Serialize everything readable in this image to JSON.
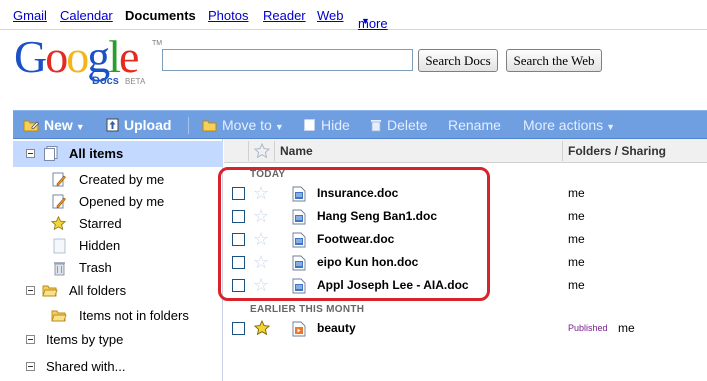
{
  "topnav": {
    "gmail": "Gmail",
    "calendar": "Calendar",
    "documents": "Documents",
    "photos": "Photos",
    "reader": "Reader",
    "web": "Web",
    "more": "more",
    "more_arrow": "▼"
  },
  "logo": {
    "word": "Google",
    "product": "Docs",
    "beta": "BETA",
    "tm": "TM"
  },
  "search": {
    "query": "",
    "search_docs_label": "Search Docs",
    "search_web_label": "Search the Web"
  },
  "toolbar": {
    "new_label": "New",
    "upload_label": "Upload",
    "move_to_label": "Move to",
    "hide_label": "Hide",
    "delete_label": "Delete",
    "rename_label": "Rename",
    "more_actions_label": "More actions",
    "arrow": "▼"
  },
  "sidebar": {
    "all_items": "All items",
    "created_by_me": "Created by me",
    "opened_by_me": "Opened by me",
    "starred": "Starred",
    "hidden": "Hidden",
    "trash": "Trash",
    "all_folders": "All folders",
    "items_not_in_folders": "Items not in folders",
    "items_by_type": "Items by type",
    "shared_with": "Shared with..."
  },
  "list": {
    "col_name": "Name",
    "col_folders": "Folders / Sharing",
    "section_today": "TODAY",
    "section_earlier": "EARLIER THIS MONTH",
    "today": [
      {
        "name": "Insurance.doc",
        "sharing": "me",
        "starred": false
      },
      {
        "name": "Hang Seng Ban1.doc",
        "sharing": "me",
        "starred": false
      },
      {
        "name": "Footwear.doc",
        "sharing": "me",
        "starred": false
      },
      {
        "name": "eipo Kun hon.doc",
        "sharing": "me",
        "starred": false
      },
      {
        "name": "Appl Joseph Lee - AIA.doc",
        "sharing": "me",
        "starred": false
      }
    ],
    "earlier": [
      {
        "name": "beauty",
        "published": "Published",
        "sharing": "me",
        "starred": true
      }
    ]
  },
  "colors": {
    "toolbar_bg": "#6f9fe0",
    "selected_bg": "#c3d9ff",
    "highlight": "#d9232b",
    "link": "#0000cc"
  },
  "icons": {
    "new": "folder-pencil-icon",
    "upload": "upload-icon",
    "move_to": "folder-icon",
    "hide": "hide-icon",
    "delete": "trash-icon",
    "doc": "document-icon",
    "presentation": "presentation-icon",
    "star": "star-icon"
  }
}
